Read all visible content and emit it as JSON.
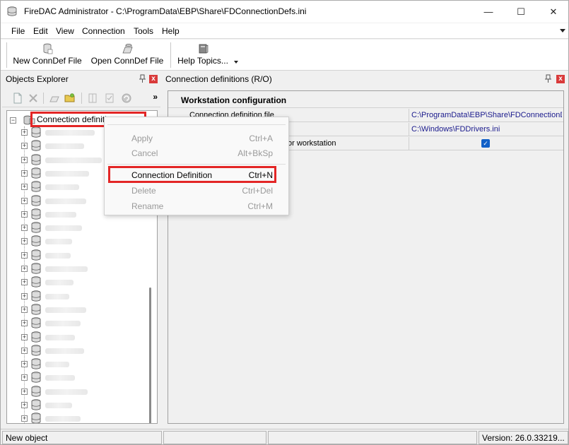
{
  "window": {
    "title": "FireDAC Administrator - C:\\ProgramData\\EBP\\Share\\FDConnectionDefs.ini",
    "minimize_glyph": "—",
    "maximize_glyph": "☐",
    "close_glyph": "✕"
  },
  "menu": {
    "file": "File",
    "edit": "Edit",
    "view": "View",
    "connection": "Connection",
    "tools": "Tools",
    "help": "Help"
  },
  "toolbar": {
    "new_conndef": "New ConnDef File",
    "open_conndef": "Open ConnDef File",
    "help_topics": "Help Topics..."
  },
  "objects_explorer": {
    "title": "Objects Explorer",
    "more": "»",
    "root_label": "Connection definitions",
    "node_count": 23
  },
  "connection_panel": {
    "title": "Connection definitions (R/O)",
    "section": "Workstation configuration",
    "rows": [
      {
        "label": "Connection definition file",
        "value": "C:\\ProgramData\\EBP\\Share\\FDConnectionDefs.ini"
      },
      {
        "label": "",
        "value": "C:\\Windows\\FDDrivers.ini"
      },
      {
        "label": "for workstation",
        "value": ""
      }
    ]
  },
  "context_menu": {
    "apply": {
      "label": "Apply",
      "shortcut": "Ctrl+A"
    },
    "cancel": {
      "label": "Cancel",
      "shortcut": "Alt+BkSp"
    },
    "connection_definition": {
      "label": "Connection Definition",
      "shortcut": "Ctrl+N"
    },
    "delete": {
      "label": "Delete",
      "shortcut": "Ctrl+Del"
    },
    "rename": {
      "label": "Rename",
      "shortcut": "Ctrl+M"
    }
  },
  "status": {
    "message": "New object",
    "version": "Version: 26.0.33219..."
  },
  "colors": {
    "highlight_red": "#e32626",
    "path_blue": "#1a1a8c",
    "checkbox_blue": "#1160c8"
  }
}
